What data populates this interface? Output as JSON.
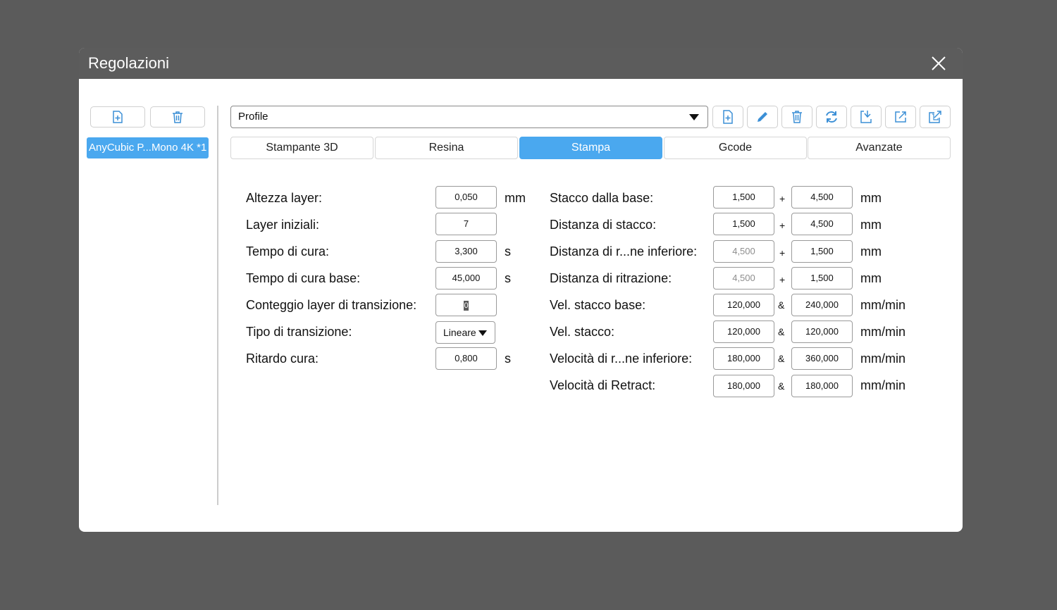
{
  "window": {
    "title": "Regolazioni"
  },
  "sidebar": {
    "printer_label": "AnyCubic P...Mono 4K *1"
  },
  "toolbar": {
    "profile_value": "Profile"
  },
  "tabs": [
    "Stampante 3D",
    "Resina",
    "Stampa",
    "Gcode",
    "Avanzate"
  ],
  "active_tab": "Stampa",
  "left_params": [
    {
      "label": "Altezza layer:",
      "value": "0,050",
      "unit": "mm"
    },
    {
      "label": "Layer iniziali:",
      "value": "7",
      "unit": ""
    },
    {
      "label": "Tempo di cura:",
      "value": "3,300",
      "unit": "s"
    },
    {
      "label": "Tempo di cura base:",
      "value": "45,000",
      "unit": "s"
    },
    {
      "label": "Conteggio layer di transizione:",
      "value": "0",
      "unit": ""
    },
    {
      "label": "Tipo di transizione:",
      "value": "Lineare",
      "unit": ""
    },
    {
      "label": "Ritardo cura:",
      "value": "0,800",
      "unit": "s"
    }
  ],
  "right_params": [
    {
      "label": "Stacco dalla base:",
      "value1": "1,500",
      "sep": "+",
      "value2": "4,500",
      "unit": "mm"
    },
    {
      "label": "Distanza di stacco:",
      "value1": "1,500",
      "sep": "+",
      "value2": "4,500",
      "unit": "mm"
    },
    {
      "label": "Distanza di r...ne inferiore:",
      "value1": "4,500",
      "sep": "+",
      "value2": "1,500",
      "unit": "mm"
    },
    {
      "label": "Distanza di ritrazione:",
      "value1": "4,500",
      "sep": "+",
      "value2": "1,500",
      "unit": "mm"
    },
    {
      "label": "Vel. stacco base:",
      "value1": "120,000",
      "sep": "&",
      "value2": "240,000",
      "unit": "mm/min"
    },
    {
      "label": "Vel. stacco:",
      "value1": "120,000",
      "sep": "&",
      "value2": "120,000",
      "unit": "mm/min"
    },
    {
      "label": "Velocità di r...ne inferiore:",
      "value1": "180,000",
      "sep": "&",
      "value2": "360,000",
      "unit": "mm/min"
    },
    {
      "label": "Velocità di Retract:",
      "value1": "180,000",
      "sep": "&",
      "value2": "180,000",
      "unit": "mm/min"
    }
  ],
  "colors": {
    "accent": "#4aa8ef",
    "titlebar": "#5c5c5c",
    "backdrop": "#5b5b5b"
  },
  "icons": [
    "file-add-icon",
    "trash-icon",
    "pencil-icon",
    "refresh-icon",
    "import-icon",
    "export-icon",
    "share-icon",
    "close-icon"
  ]
}
